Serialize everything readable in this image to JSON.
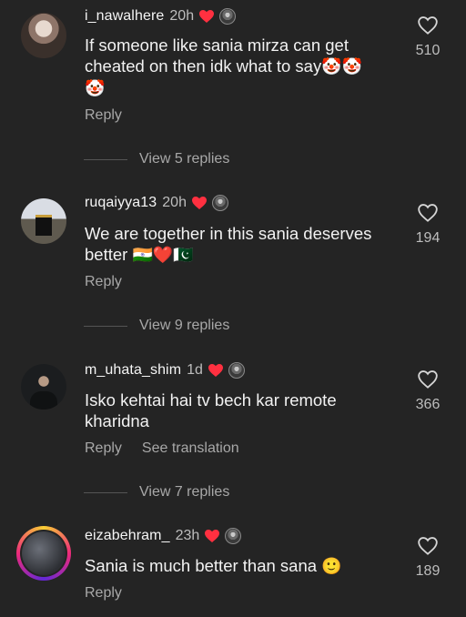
{
  "comments": [
    {
      "username": "i_nawalhere",
      "time": "20h",
      "text": "If someone like sania mirza can get cheated on then idk what to say",
      "emoji_line1": "🤡🤡",
      "emoji_line2": "🤡",
      "reply": "Reply",
      "likes": "510",
      "view_replies": "View 5 replies"
    },
    {
      "username": "ruqaiyya13",
      "time": "20h",
      "text_line1": "We are together in this sania deserves",
      "text_line2": "better",
      "emojis": "🇮🇳❤️🇵🇰",
      "reply": "Reply",
      "likes": "194",
      "view_replies": "View 9 replies"
    },
    {
      "username": "m_uhata_shim",
      "time": "1d",
      "text_line1": "Isko kehtai hai tv bech kar remote",
      "text_line2": "kharidna",
      "reply": "Reply",
      "see_translation": "See translation",
      "likes": "366",
      "view_replies": "View 7 replies"
    },
    {
      "username": "eizabehram_",
      "time": "23h",
      "text": "Sania is much better than sana",
      "emoji": "🙂",
      "reply": "Reply",
      "likes": "189"
    }
  ],
  "colors": {
    "background": "#242424",
    "heart": "#ff3040",
    "muted": "#a8a8a8"
  },
  "icons": [
    "heart-icon",
    "like-heart-outline-icon",
    "creator-avatar-icon"
  ]
}
